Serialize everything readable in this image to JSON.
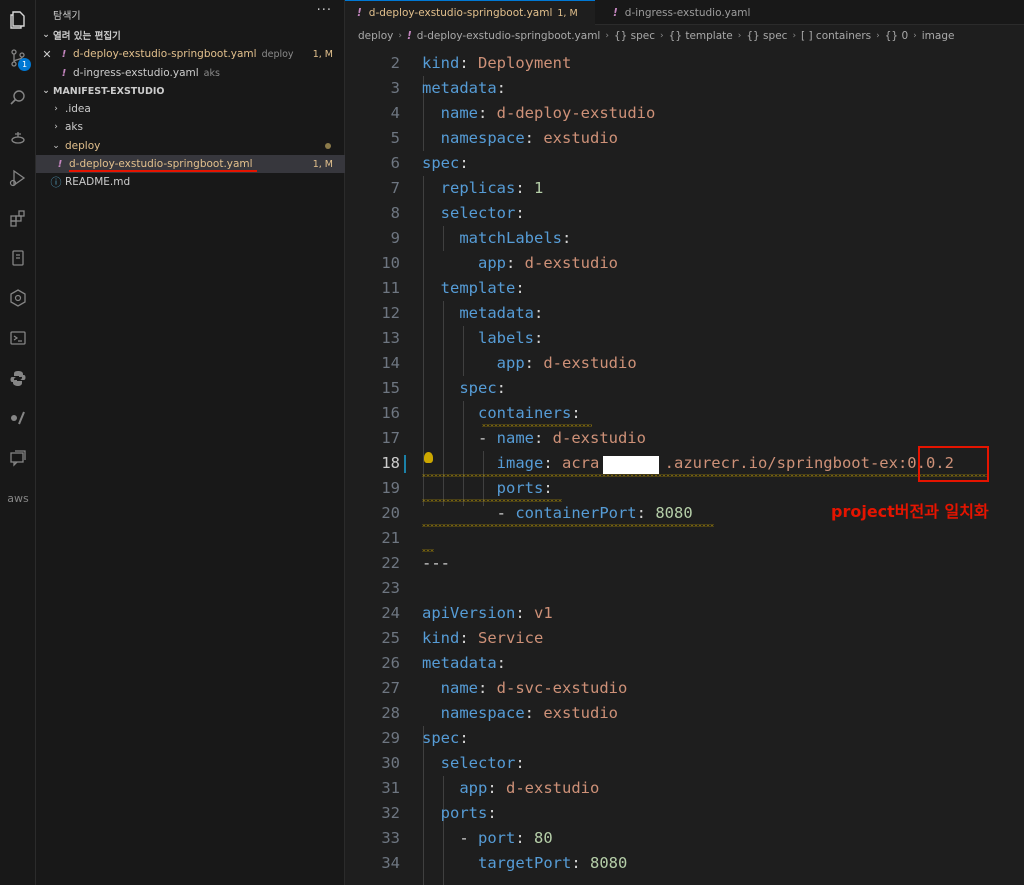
{
  "sidebar": {
    "title": "탐색기",
    "more": "···",
    "open_editors_header": "열려 있는 편집기",
    "open_editors": [
      {
        "name": "d-deploy-exstudio-springboot.yaml",
        "desc": "deploy",
        "status": "1, M"
      },
      {
        "name": "d-ingress-exstudio.yaml",
        "desc": "aks"
      }
    ],
    "workspace_header": "MANIFEST-EXSTUDIO",
    "tree": [
      {
        "name": ".idea"
      },
      {
        "name": "aks"
      },
      {
        "name": "deploy"
      },
      {
        "name": "d-deploy-exstudio-springboot.yaml",
        "status": "1, M"
      },
      {
        "name": "README.md"
      }
    ]
  },
  "activity": {
    "badge": "1",
    "aws": "aws"
  },
  "tabs": [
    {
      "name": "d-deploy-exstudio-springboot.yaml",
      "status": "1, M"
    },
    {
      "name": "d-ingress-exstudio.yaml"
    }
  ],
  "breadcrumb": [
    "deploy",
    "d-deploy-exstudio-springboot.yaml",
    "{} spec",
    "{} template",
    "{} spec",
    "[ ] containers",
    "{} 0",
    "image"
  ],
  "editor": {
    "active_line": 18,
    "lines": [
      {
        "n": "2",
        "t": [
          [
            "k",
            "kind"
          ],
          [
            "p",
            ": "
          ],
          [
            "s",
            "Deployment"
          ]
        ]
      },
      {
        "n": "3",
        "t": [
          [
            "k",
            "metadata"
          ],
          [
            "p",
            ":"
          ]
        ]
      },
      {
        "n": "4",
        "t": [
          [
            "p",
            "  "
          ],
          [
            "k",
            "name"
          ],
          [
            "p",
            ": "
          ],
          [
            "s",
            "d-deploy-exstudio"
          ]
        ]
      },
      {
        "n": "5",
        "t": [
          [
            "p",
            "  "
          ],
          [
            "k",
            "namespace"
          ],
          [
            "p",
            ": "
          ],
          [
            "s",
            "exstudio"
          ]
        ]
      },
      {
        "n": "6",
        "t": [
          [
            "k",
            "spec"
          ],
          [
            "p",
            ":"
          ]
        ]
      },
      {
        "n": "7",
        "t": [
          [
            "p",
            "  "
          ],
          [
            "k",
            "replicas"
          ],
          [
            "p",
            ": "
          ],
          [
            "n",
            "1"
          ]
        ]
      },
      {
        "n": "8",
        "t": [
          [
            "p",
            "  "
          ],
          [
            "k",
            "selector"
          ],
          [
            "p",
            ":"
          ]
        ]
      },
      {
        "n": "9",
        "t": [
          [
            "p",
            "    "
          ],
          [
            "k",
            "matchLabels"
          ],
          [
            "p",
            ":"
          ]
        ]
      },
      {
        "n": "10",
        "t": [
          [
            "p",
            "      "
          ],
          [
            "k",
            "app"
          ],
          [
            "p",
            ": "
          ],
          [
            "s",
            "d-exstudio"
          ]
        ]
      },
      {
        "n": "11",
        "t": [
          [
            "p",
            "  "
          ],
          [
            "k",
            "template"
          ],
          [
            "p",
            ":"
          ]
        ]
      },
      {
        "n": "12",
        "t": [
          [
            "p",
            "    "
          ],
          [
            "k",
            "metadata"
          ],
          [
            "p",
            ":"
          ]
        ]
      },
      {
        "n": "13",
        "t": [
          [
            "p",
            "      "
          ],
          [
            "k",
            "labels"
          ],
          [
            "p",
            ":"
          ]
        ]
      },
      {
        "n": "14",
        "t": [
          [
            "p",
            "        "
          ],
          [
            "k",
            "app"
          ],
          [
            "p",
            ": "
          ],
          [
            "s",
            "d-exstudio"
          ]
        ]
      },
      {
        "n": "15",
        "t": [
          [
            "p",
            "    "
          ],
          [
            "k",
            "spec"
          ],
          [
            "p",
            ":"
          ]
        ]
      },
      {
        "n": "16",
        "t": [
          [
            "p",
            "      "
          ],
          [
            "k",
            "containers"
          ],
          [
            "p",
            ":"
          ]
        ]
      },
      {
        "n": "17",
        "t": [
          [
            "p",
            "      - "
          ],
          [
            "k",
            "name"
          ],
          [
            "p",
            ": "
          ],
          [
            "s",
            "d-exstudio"
          ]
        ]
      },
      {
        "n": "18",
        "t": [
          [
            "p",
            "        "
          ],
          [
            "k",
            "image"
          ],
          [
            "p",
            ": "
          ],
          [
            "s",
            "acra       .azurecr.io/springboot-ex:0.0.2"
          ]
        ]
      },
      {
        "n": "19",
        "t": [
          [
            "p",
            "        "
          ],
          [
            "k",
            "ports"
          ],
          [
            "p",
            ":"
          ]
        ]
      },
      {
        "n": "20",
        "t": [
          [
            "p",
            "        - "
          ],
          [
            "k",
            "containerPort"
          ],
          [
            "p",
            ": "
          ],
          [
            "n",
            "8080"
          ]
        ]
      },
      {
        "n": "21",
        "t": []
      },
      {
        "n": "22",
        "t": [
          [
            "p",
            "---"
          ]
        ]
      },
      {
        "n": "23",
        "t": []
      },
      {
        "n": "24",
        "t": [
          [
            "k",
            "apiVersion"
          ],
          [
            "p",
            ": "
          ],
          [
            "s",
            "v1"
          ]
        ]
      },
      {
        "n": "25",
        "t": [
          [
            "k",
            "kind"
          ],
          [
            "p",
            ": "
          ],
          [
            "s",
            "Service"
          ]
        ]
      },
      {
        "n": "26",
        "t": [
          [
            "k",
            "metadata"
          ],
          [
            "p",
            ":"
          ]
        ]
      },
      {
        "n": "27",
        "t": [
          [
            "p",
            "  "
          ],
          [
            "k",
            "name"
          ],
          [
            "p",
            ": "
          ],
          [
            "s",
            "d-svc-exstudio"
          ]
        ]
      },
      {
        "n": "28",
        "t": [
          [
            "p",
            "  "
          ],
          [
            "k",
            "namespace"
          ],
          [
            "p",
            ": "
          ],
          [
            "s",
            "exstudio"
          ]
        ]
      },
      {
        "n": "29",
        "t": [
          [
            "k",
            "spec"
          ],
          [
            "p",
            ":"
          ]
        ]
      },
      {
        "n": "30",
        "t": [
          [
            "p",
            "  "
          ],
          [
            "k",
            "selector"
          ],
          [
            "p",
            ":"
          ]
        ]
      },
      {
        "n": "31",
        "t": [
          [
            "p",
            "    "
          ],
          [
            "k",
            "app"
          ],
          [
            "p",
            ": "
          ],
          [
            "s",
            "d-exstudio"
          ]
        ]
      },
      {
        "n": "32",
        "t": [
          [
            "p",
            "  "
          ],
          [
            "k",
            "ports"
          ],
          [
            "p",
            ":"
          ]
        ]
      },
      {
        "n": "33",
        "t": [
          [
            "p",
            "    - "
          ],
          [
            "k",
            "port"
          ],
          [
            "p",
            ": "
          ],
          [
            "n",
            "80"
          ]
        ]
      },
      {
        "n": "34",
        "t": [
          [
            "p",
            "      "
          ],
          [
            "k",
            "targetPort"
          ],
          [
            "p",
            ": "
          ],
          [
            "n",
            "8080"
          ]
        ]
      }
    ]
  },
  "annotation": "project버전과 일치화"
}
